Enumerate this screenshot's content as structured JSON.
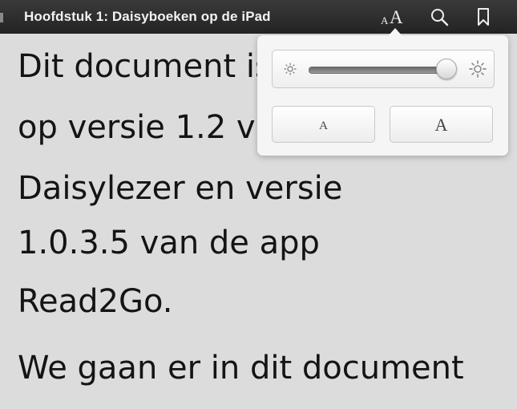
{
  "toolbar": {
    "title": "Hoofdstuk 1: Daisyboeken op de iPad",
    "font_small": "A",
    "font_big": "A",
    "search_icon": "search-icon",
    "bookmark_icon": "bookmark-icon"
  },
  "content": {
    "lines": [
      "Dit document is",
      "op versie 1.2 v",
      "Daisylezer en versie",
      "1.0.3.5 van de app",
      "Read2Go.",
      "We gaan er in dit document"
    ]
  },
  "popover": {
    "brightness_level": 0.96,
    "smaller_label": "A",
    "larger_label": "A"
  },
  "colors": {
    "toolbar_bg": "#2b2b2b",
    "page_bg": "#dcdcdc",
    "popover_bg": "#f5f5f5"
  }
}
